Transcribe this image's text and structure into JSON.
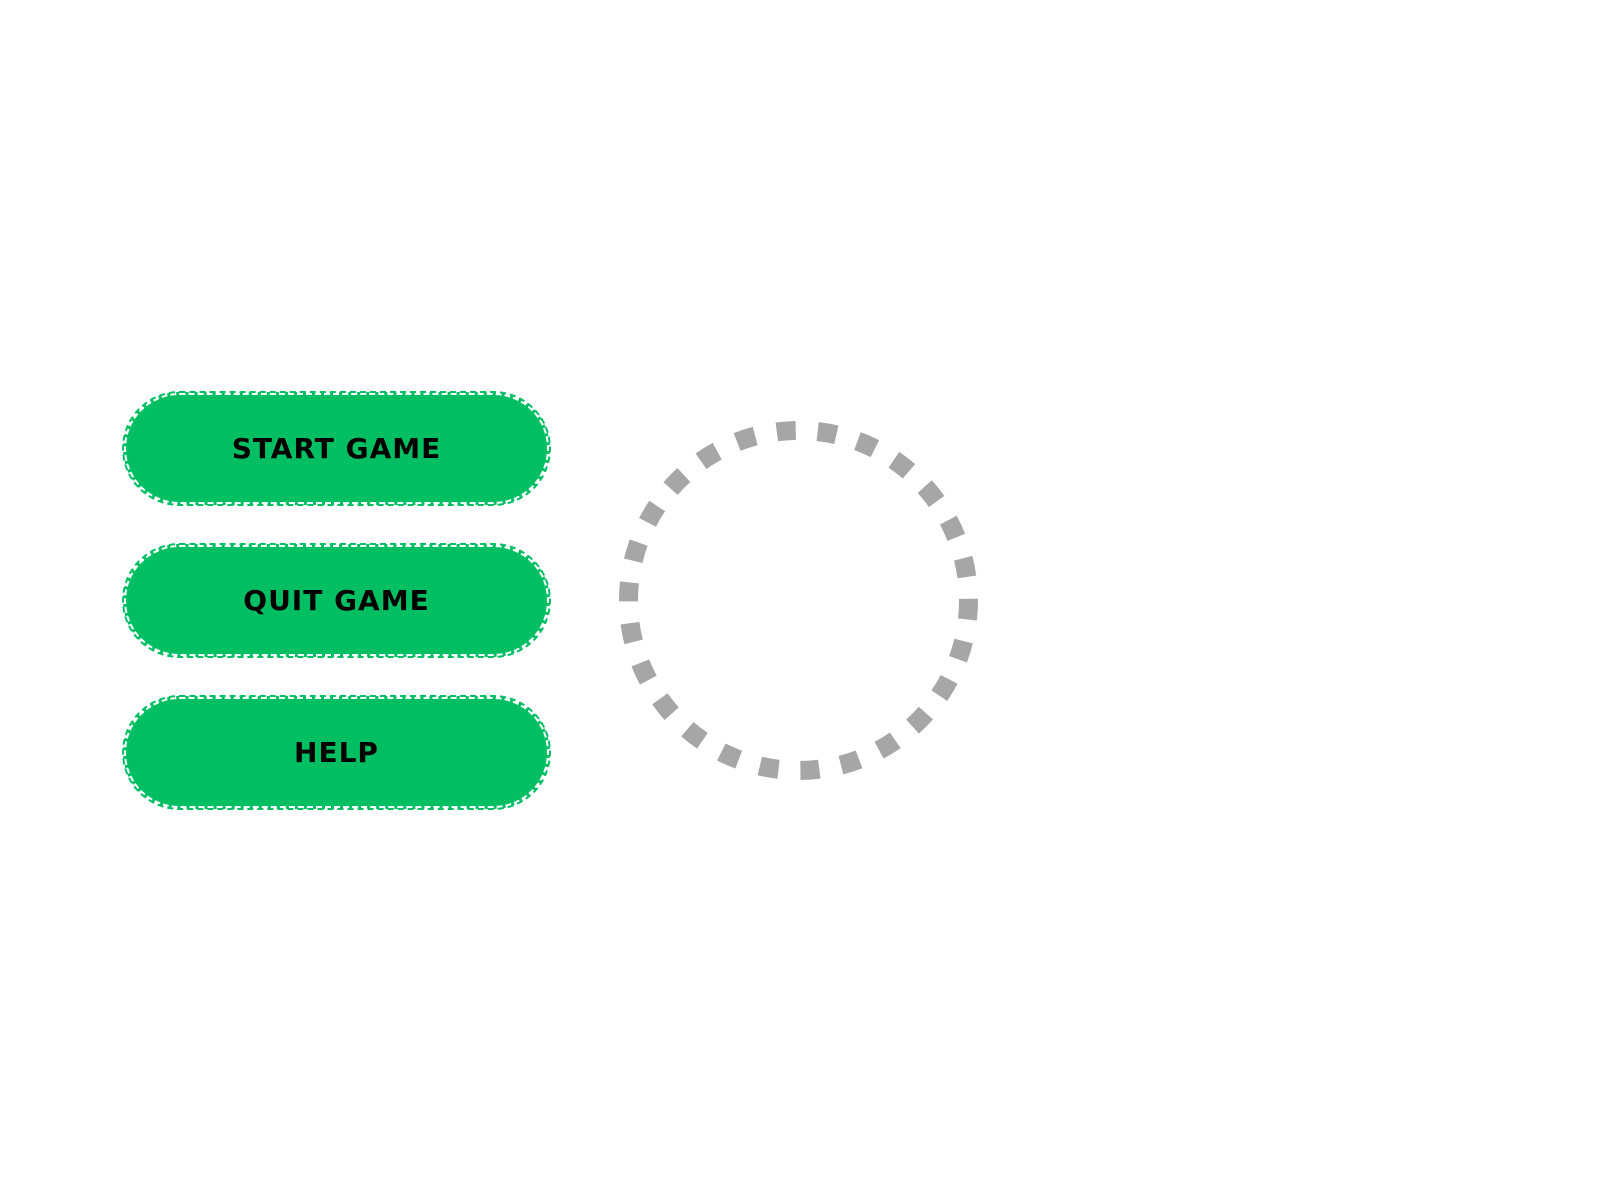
{
  "menu": {
    "buttons": [
      {
        "label": "START GAME"
      },
      {
        "label": "QUIT GAME"
      },
      {
        "label": "HELP"
      }
    ]
  },
  "loading_spinner": {
    "icon": "loading-spinner-icon"
  },
  "colors": {
    "button_fill": "#00bf63",
    "button_text": "#000000",
    "spinner_stroke": "#a6a6a6",
    "background": "#ffffff"
  }
}
